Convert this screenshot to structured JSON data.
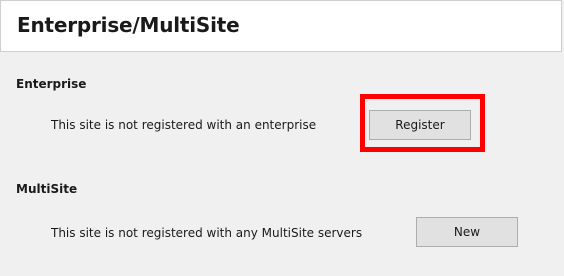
{
  "header": {
    "title": "Enterprise/MultiSite"
  },
  "enterprise": {
    "heading": "Enterprise",
    "status": "This site is not registered with an enterprise",
    "button_label": "Register",
    "highlight_color": "#ff0000"
  },
  "multisite": {
    "heading": "MultiSite",
    "status": "This site is not registered with any MultiSite servers",
    "button_label": "New"
  }
}
